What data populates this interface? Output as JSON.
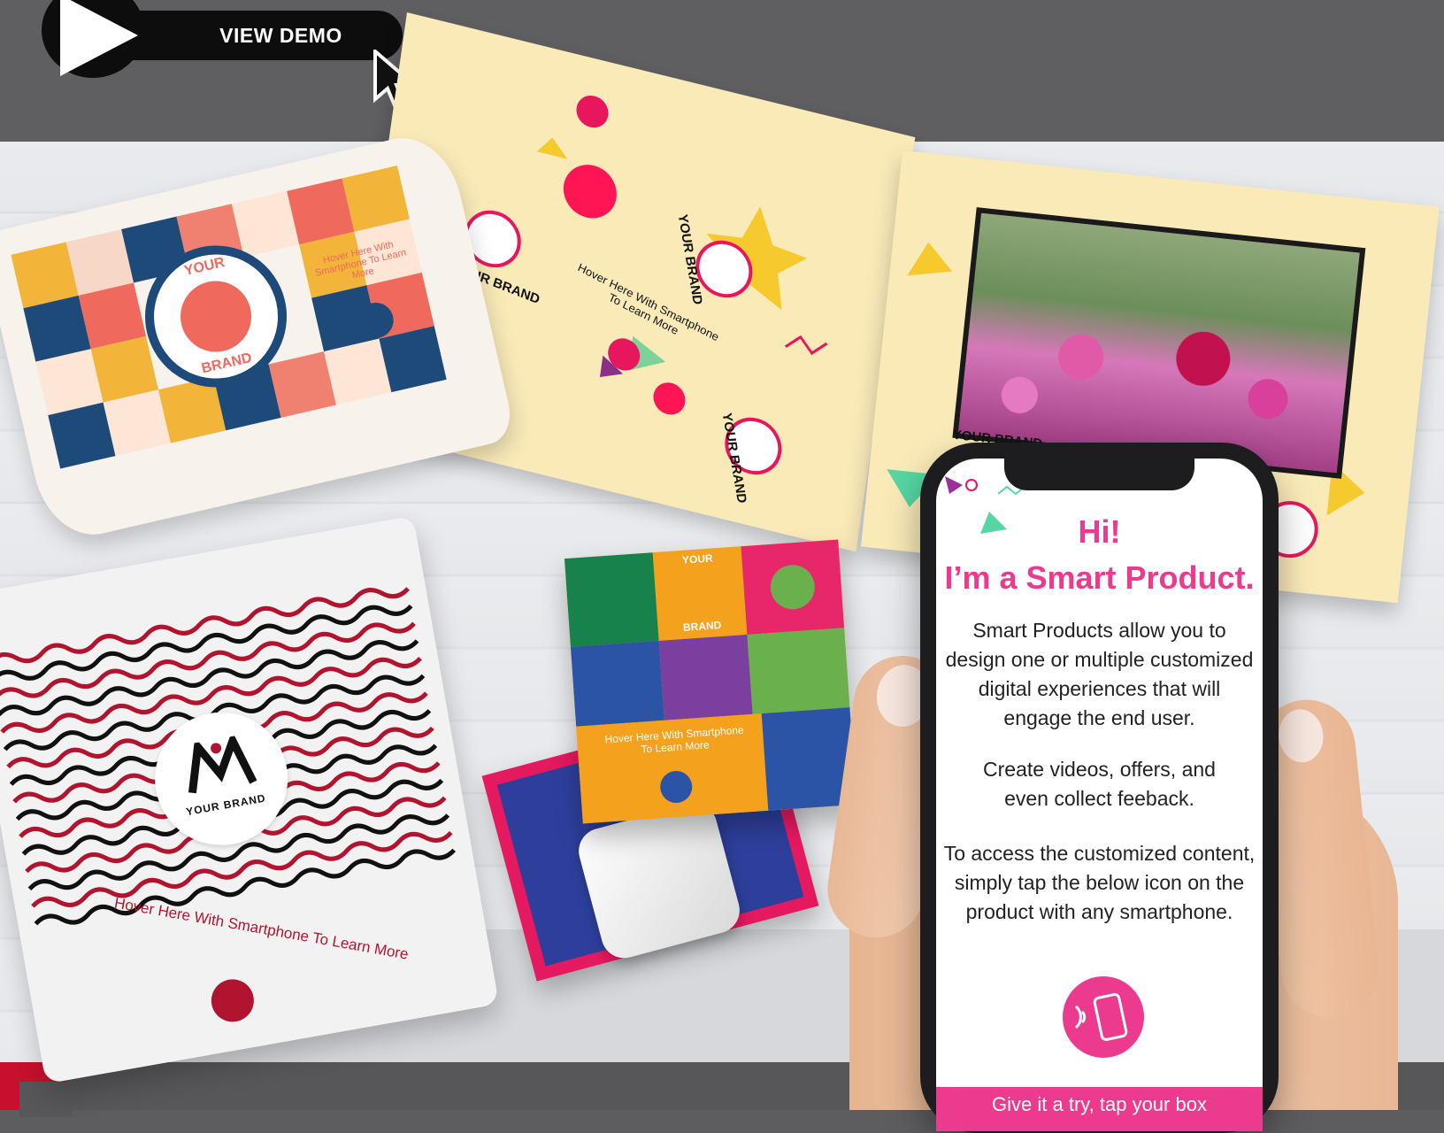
{
  "demo": {
    "label": "VIEW DEMO"
  },
  "pillow_box": {
    "brand_top": "YOUR",
    "brand_bottom": "BRAND",
    "hover_text": "Hover Here With Smartphone To Learn More"
  },
  "video_card": {
    "brand_label": "YOUR BRAND",
    "hover_text_line1": "Hover Here With Smartphone",
    "hover_text_line2": "To Learn More"
  },
  "mailer": {
    "brand_label": "YOUR BRAND",
    "hover_text": "Hover Here With Smartphone To Learn More"
  },
  "square_box": {
    "brand_top": "YOUR",
    "brand_bottom": "BRAND",
    "hover_text_line1": "Hover Here With Smartphone",
    "hover_text_line2": "To Learn More"
  },
  "phone": {
    "greeting": "Hi!",
    "headline": "I’m a Smart Product.",
    "para1": [
      "Smart Products allow you to",
      "design one or multiple customized",
      "digital experiences that will",
      "engage the end user."
    ],
    "para2": [
      "Create videos, offers, and",
      "even collect feeback."
    ],
    "para3": [
      "To access the customized content,",
      "simply tap the below icon on the",
      "product with any smartphone."
    ],
    "cta": "Give it a try, tap your box"
  },
  "colors": {
    "accent_pink": "#ec3a8f",
    "mailer_red": "#b0142e",
    "card_cream": "#f9eab8"
  },
  "icons": [
    "play-icon",
    "cursor-arrow-icon",
    "nfc-tap-icon",
    "play-pause-icon",
    "volume-icon"
  ]
}
